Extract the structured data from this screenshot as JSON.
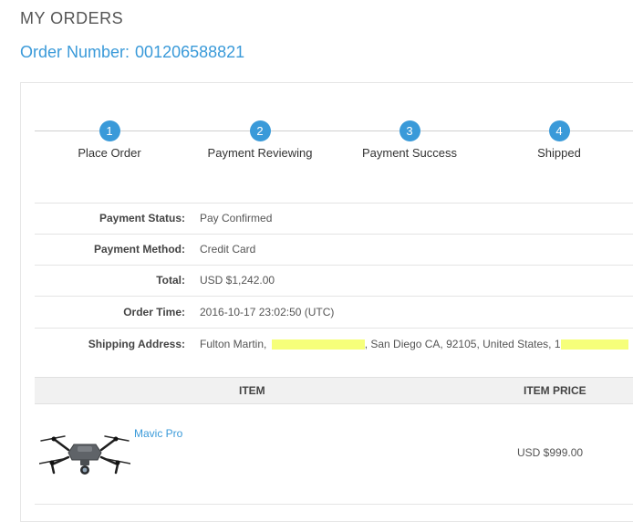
{
  "page": {
    "title": "MY ORDERS",
    "order_number_label": "Order Number:",
    "order_number": "001206588821"
  },
  "steps": [
    {
      "number": "1",
      "label": "Place Order"
    },
    {
      "number": "2",
      "label": "Payment Reviewing"
    },
    {
      "number": "3",
      "label": "Payment Success"
    },
    {
      "number": "4",
      "label": "Shipped"
    }
  ],
  "details": {
    "payment_status": {
      "label": "Payment Status:",
      "value": "Pay Confirmed"
    },
    "payment_method": {
      "label": "Payment Method:",
      "value": "Credit Card"
    },
    "total": {
      "label": "Total:",
      "value": "USD $1,242.00"
    },
    "order_time": {
      "label": "Order Time:",
      "value": "2016-10-17 23:02:50 (UTC)"
    },
    "shipping_address": {
      "label": "Shipping Address:",
      "name": "Fulton Martin,",
      "city_line": ", San Diego CA, 92105, United States,",
      "phone_prefix": "1"
    }
  },
  "items_table": {
    "columns": {
      "item": "ITEM",
      "price": "ITEM PRICE"
    },
    "rows": [
      {
        "name": "Mavic Pro",
        "price": "USD $999.00",
        "image": "drone-image"
      }
    ]
  },
  "colors": {
    "accent": "#3a9ad9",
    "redaction": "#f6ff7a"
  }
}
